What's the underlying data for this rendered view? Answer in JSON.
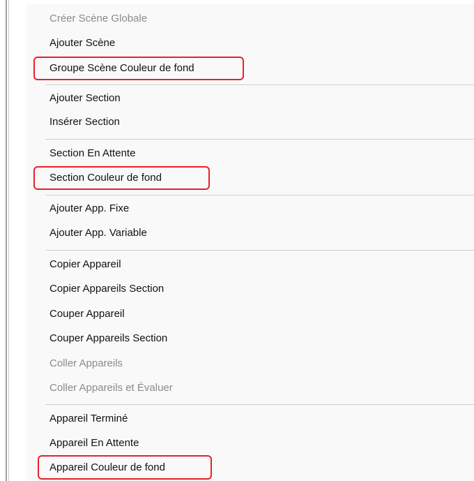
{
  "menu": {
    "items": [
      {
        "label": "Créer Scène Globale",
        "enabled": false
      },
      {
        "label": "Ajouter Scène",
        "enabled": true
      },
      {
        "label": "Groupe Scène Couleur de fond",
        "enabled": true,
        "highlighted": true
      },
      {
        "label": "Ajouter Section",
        "enabled": true
      },
      {
        "label": "Insérer Section",
        "enabled": true
      },
      {
        "label": "Section En Attente",
        "enabled": true
      },
      {
        "label": "Section Couleur de fond",
        "enabled": true,
        "highlighted": true
      },
      {
        "label": "Ajouter App. Fixe",
        "enabled": true
      },
      {
        "label": "Ajouter App. Variable",
        "enabled": true
      },
      {
        "label": "Copier Appareil",
        "enabled": true
      },
      {
        "label": "Copier Appareils Section",
        "enabled": true
      },
      {
        "label": "Couper Appareil",
        "enabled": true
      },
      {
        "label": "Couper Appareils Section",
        "enabled": true
      },
      {
        "label": "Coller Appareils",
        "enabled": false
      },
      {
        "label": "Coller Appareils et Évaluer",
        "enabled": false
      },
      {
        "label": "Appareil Terminé",
        "enabled": true
      },
      {
        "label": "Appareil En Attente",
        "enabled": true
      },
      {
        "label": "Appareil Couleur de fond",
        "enabled": true,
        "highlighted": true
      }
    ]
  },
  "colors": {
    "menu_background": "#f9f9f9",
    "text": "#111111",
    "disabled_text": "#8a8a8a",
    "separator": "#cfcfcf",
    "highlight_outline": "#e8202a"
  }
}
